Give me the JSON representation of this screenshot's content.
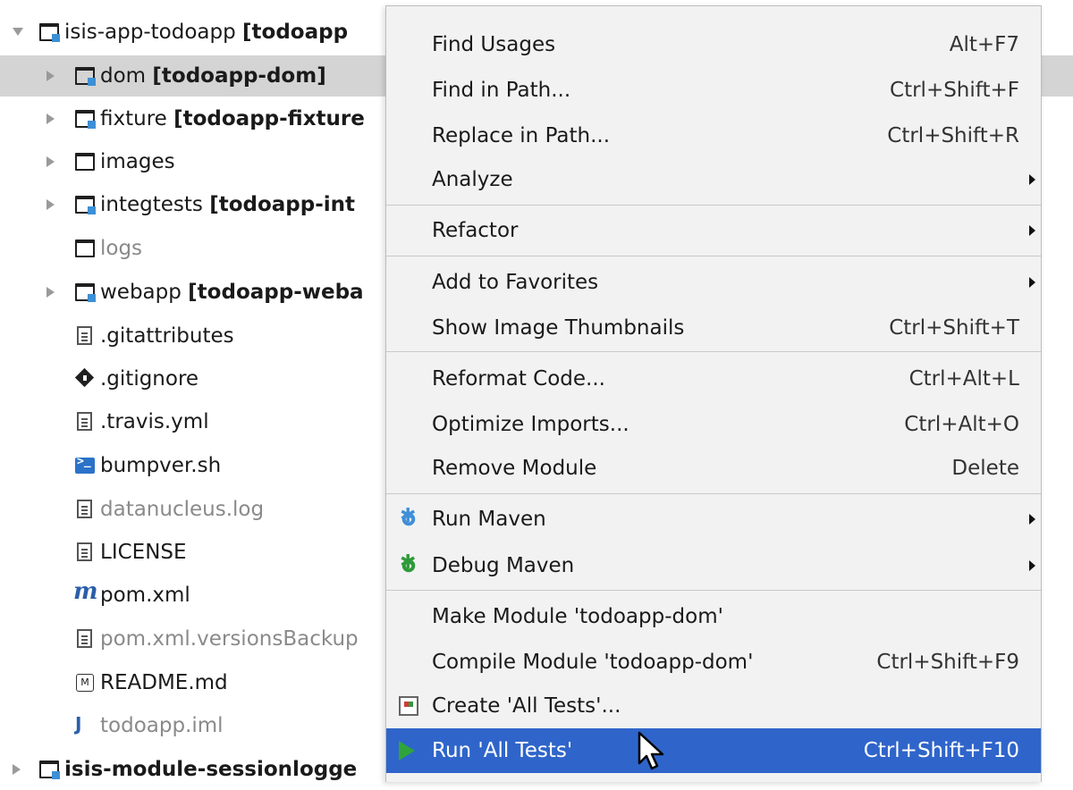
{
  "tree": {
    "root": {
      "name": "isis-app-todoapp",
      "module": "[todoapp"
    },
    "items": [
      {
        "name": "dom",
        "module": "[todoapp-dom]"
      },
      {
        "name": "fixture",
        "module": "[todoapp-fixture"
      },
      {
        "name": "images"
      },
      {
        "name": "integtests",
        "module": "[todoapp-int"
      },
      {
        "name": "logs"
      },
      {
        "name": "webapp",
        "module": "[todoapp-weba"
      },
      {
        "name": ".gitattributes"
      },
      {
        "name": ".gitignore"
      },
      {
        "name": ".travis.yml"
      },
      {
        "name": "bumpver.sh"
      },
      {
        "name": "datanucleus.log"
      },
      {
        "name": "LICENSE"
      },
      {
        "name": "pom.xml"
      },
      {
        "name": "pom.xml.versionsBackup"
      },
      {
        "name": "README.md"
      },
      {
        "name": "todoapp.iml"
      }
    ],
    "next_module": {
      "name": "isis-module-sessionlogge"
    }
  },
  "menu": {
    "items": [
      {
        "label": "Find Usages",
        "shortcut": "Alt+F7"
      },
      {
        "label": "Find in Path...",
        "shortcut": "Ctrl+Shift+F"
      },
      {
        "label": "Replace in Path...",
        "shortcut": "Ctrl+Shift+R"
      },
      {
        "label": "Analyze",
        "shortcut": ""
      },
      {
        "label": "Refactor",
        "shortcut": ""
      },
      {
        "label": "Add to Favorites",
        "shortcut": ""
      },
      {
        "label": "Show Image Thumbnails",
        "shortcut": "Ctrl+Shift+T"
      },
      {
        "label": "Reformat Code...",
        "shortcut": "Ctrl+Alt+L"
      },
      {
        "label": "Optimize Imports...",
        "shortcut": "Ctrl+Alt+O"
      },
      {
        "label": "Remove Module",
        "shortcut": "Delete"
      },
      {
        "label": "Run Maven",
        "shortcut": ""
      },
      {
        "label": "Debug Maven",
        "shortcut": ""
      },
      {
        "label": "Make Module 'todoapp-dom'",
        "shortcut": ""
      },
      {
        "label": "Compile Module 'todoapp-dom'",
        "shortcut": "Ctrl+Shift+F9"
      },
      {
        "label": "Create 'All Tests'...",
        "shortcut": ""
      },
      {
        "label": "Run 'All Tests'",
        "shortcut": "Ctrl+Shift+F10"
      }
    ]
  },
  "colors": {
    "selection": "#2f65ca",
    "tree_selected": "#d4d4d4",
    "menu_bg": "#f2f2f2"
  }
}
